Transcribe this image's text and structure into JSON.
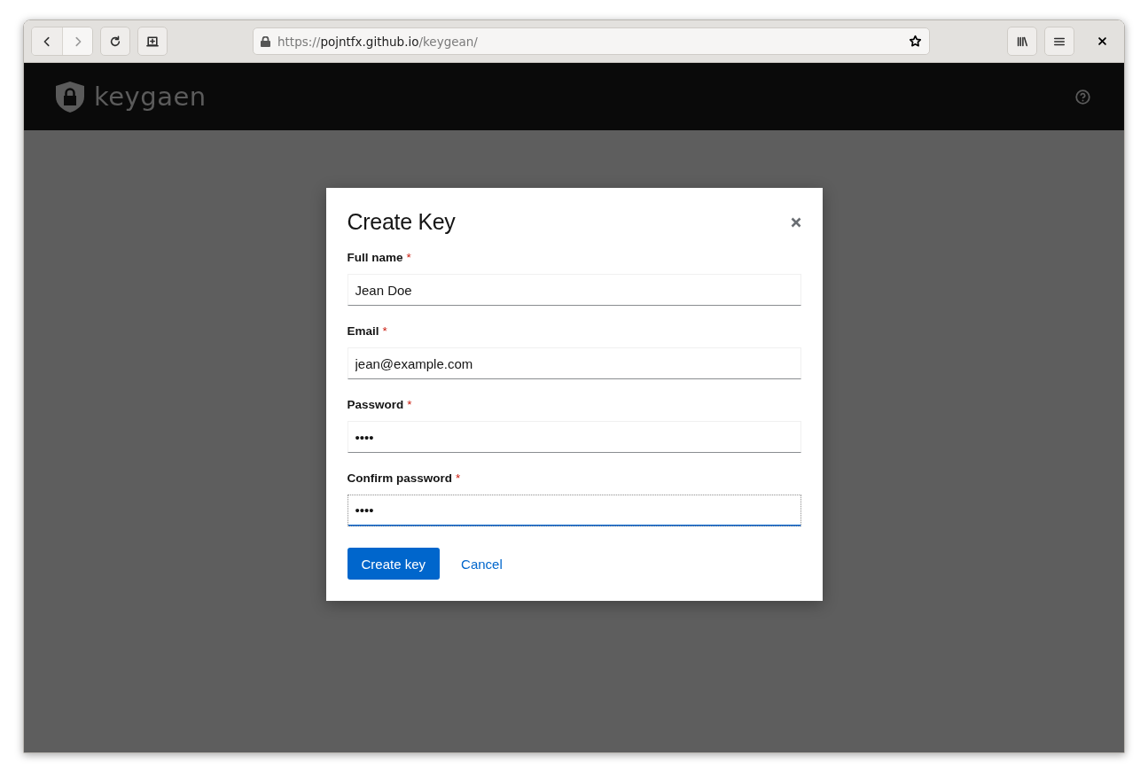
{
  "browser": {
    "url": {
      "scheme": "https://",
      "host": "pojntfx.github.io",
      "path": "/keygean/"
    },
    "back_disabled": false,
    "forward_disabled": true
  },
  "header": {
    "brand": "keygaen"
  },
  "dialog": {
    "title": "Create Key",
    "fields": [
      {
        "label": "Full name",
        "required_mark": "*",
        "value": "Jean Doe",
        "focused": false
      },
      {
        "label": "Email",
        "required_mark": "*",
        "value": "jean@example.com",
        "focused": false
      },
      {
        "label": "Password",
        "required_mark": "*",
        "value": "••••",
        "focused": false
      },
      {
        "label": "Confirm password",
        "required_mark": "*",
        "value": "••••",
        "focused": true
      }
    ],
    "primary_button": "Create key",
    "cancel_link": "Cancel"
  }
}
